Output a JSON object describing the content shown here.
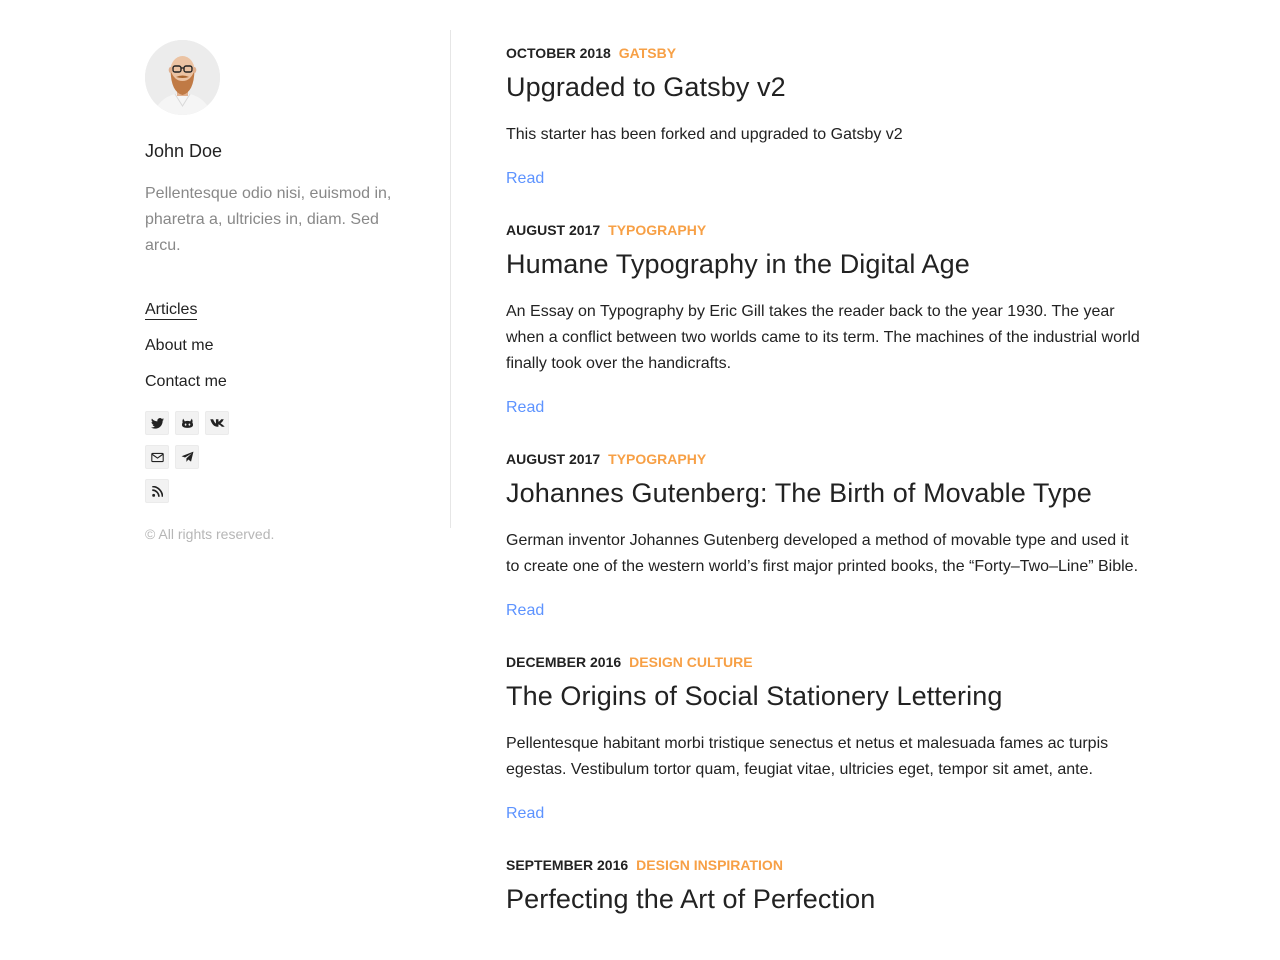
{
  "sidebar": {
    "author_name": "John Doe",
    "author_bio": "Pellentesque odio nisi, euismod in, pharetra a, ultricies in, diam. Sed arcu.",
    "menu": [
      {
        "label": "Articles",
        "active": true
      },
      {
        "label": "About me",
        "active": false
      },
      {
        "label": "Contact me",
        "active": false
      }
    ],
    "contacts": [
      {
        "icon": "twitter-icon"
      },
      {
        "icon": "github-icon"
      },
      {
        "icon": "vk-icon"
      },
      {
        "icon": "email-icon"
      },
      {
        "icon": "telegram-icon"
      },
      {
        "icon": "rss-icon"
      }
    ],
    "copyright": "© All rights reserved."
  },
  "feed": {
    "read_label": "Read",
    "posts": [
      {
        "date": "OCTOBER 2018",
        "category": "GATSBY",
        "title": "Upgraded to Gatsby v2",
        "description": "This starter has been forked and upgraded to Gatsby v2"
      },
      {
        "date": "AUGUST 2017",
        "category": "TYPOGRAPHY",
        "title": "Humane Typography in the Digital Age",
        "description": "An Essay on Typography by Eric Gill takes the reader back to the year 1930. The year when a conflict between two worlds came to its term. The machines of the industrial world finally took over the handicrafts."
      },
      {
        "date": "AUGUST 2017",
        "category": "TYPOGRAPHY",
        "title": "Johannes Gutenberg: The Birth of Movable Type",
        "description": "German inventor Johannes Gutenberg developed a method of movable type and used it to create one of the western world’s first major printed books, the “Forty–Two–Line” Bible."
      },
      {
        "date": "DECEMBER 2016",
        "category": "DESIGN CULTURE",
        "title": "The Origins of Social Stationery Lettering",
        "description": "Pellentesque habitant morbi tristique senectus et netus et malesuada fames ac turpis egestas. Vestibulum tortor quam, feugiat vitae, ultricies eget, tempor sit amet, ante."
      },
      {
        "date": "SEPTEMBER 2016",
        "category": "DESIGN INSPIRATION",
        "title": "Perfecting the Art of Perfection",
        "description": ""
      }
    ]
  },
  "colors": {
    "accent": "#f7a046",
    "link": "#5d93ff",
    "text": "#222222",
    "muted": "#888888"
  }
}
